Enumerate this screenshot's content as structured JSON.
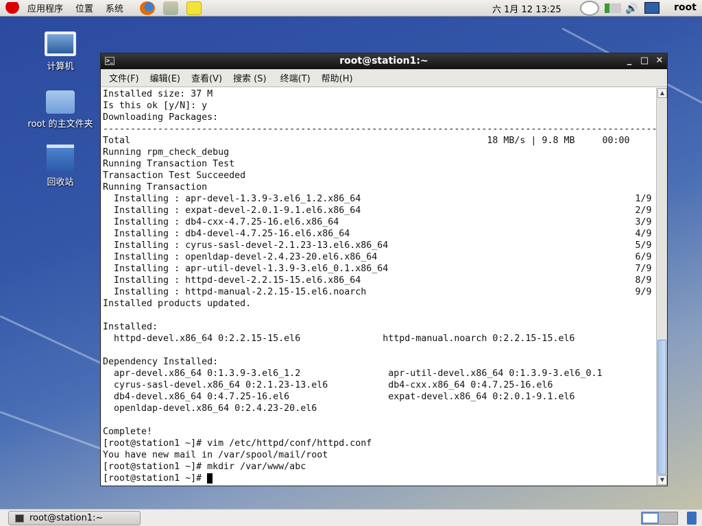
{
  "top_panel": {
    "menus": [
      "应用程序",
      "位置",
      "系统"
    ],
    "clock": "六 1月 12 13:25",
    "user": "root"
  },
  "desktop_icons": [
    {
      "label": "计算机"
    },
    {
      "label": "root 的主文件夹"
    },
    {
      "label": "回收站"
    }
  ],
  "window": {
    "title": "root@station1:~",
    "menus": [
      "文件(F)",
      "编辑(E)",
      "查看(V)",
      "搜索 (S)",
      "终端(T)",
      "帮助(H)"
    ]
  },
  "terminal": {
    "head": [
      "Installed size: 37 M",
      "Is this ok [y/N]: y",
      "Downloading Packages:"
    ],
    "total": {
      "label": "Total",
      "speed": "18 MB/s | 9.8 MB",
      "time": "00:00"
    },
    "pre_install": [
      "Running rpm_check_debug",
      "Running Transaction Test",
      "Transaction Test Succeeded",
      "Running Transaction"
    ],
    "installing": [
      {
        "pkg": "apr-devel-1.3.9-3.el6_1.2.x86_64",
        "n": "1/9"
      },
      {
        "pkg": "expat-devel-2.0.1-9.1.el6.x86_64",
        "n": "2/9"
      },
      {
        "pkg": "db4-cxx-4.7.25-16.el6.x86_64",
        "n": "3/9"
      },
      {
        "pkg": "db4-devel-4.7.25-16.el6.x86_64",
        "n": "4/9"
      },
      {
        "pkg": "cyrus-sasl-devel-2.1.23-13.el6.x86_64",
        "n": "5/9"
      },
      {
        "pkg": "openldap-devel-2.4.23-20.el6.x86_64",
        "n": "6/9"
      },
      {
        "pkg": "apr-util-devel-1.3.9-3.el6_0.1.x86_64",
        "n": "7/9"
      },
      {
        "pkg": "httpd-devel-2.2.15-15.el6.x86_64",
        "n": "8/9"
      },
      {
        "pkg": "httpd-manual-2.2.15-15.el6.noarch",
        "n": "9/9"
      }
    ],
    "installing_prefix": "Installing : ",
    "updated": "Installed products updated.",
    "installed_label": "Installed:",
    "installed": [
      [
        "httpd-devel.x86_64 0:2.2.15-15.el6",
        "httpd-manual.noarch 0:2.2.15-15.el6"
      ]
    ],
    "dep_label": "Dependency Installed:",
    "deps": [
      [
        "apr-devel.x86_64 0:1.3.9-3.el6_1.2",
        "apr-util-devel.x86_64 0:1.3.9-3.el6_0.1"
      ],
      [
        "cyrus-sasl-devel.x86_64 0:2.1.23-13.el6",
        "db4-cxx.x86_64 0:4.7.25-16.el6"
      ],
      [
        "db4-devel.x86_64 0:4.7.25-16.el6",
        "expat-devel.x86_64 0:2.0.1-9.1.el6"
      ],
      [
        "openldap-devel.x86_64 0:2.4.23-20.el6",
        ""
      ]
    ],
    "tail": [
      "Complete!",
      "[root@station1 ~]# vim /etc/httpd/conf/httpd.conf",
      "You have new mail in /var/spool/mail/root",
      "[root@station1 ~]# mkdir /var/www/abc"
    ],
    "prompt": "[root@station1 ~]# "
  },
  "taskbar": {
    "task": "root@station1:~"
  }
}
